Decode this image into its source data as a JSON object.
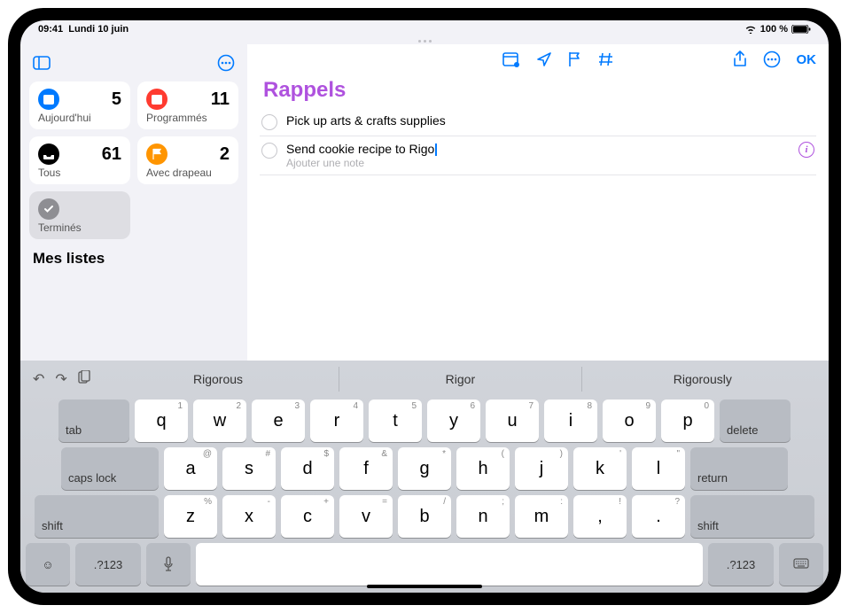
{
  "status": {
    "time": "09:41",
    "date": "Lundi 10 juin",
    "battery": "100 %"
  },
  "sidebar": {
    "smart": [
      {
        "label": "Aujourd'hui",
        "count": "5",
        "color": "#007aff",
        "icon": "cal"
      },
      {
        "label": "Programmés",
        "count": "11",
        "color": "#ff3b30",
        "icon": "cal"
      },
      {
        "label": "Tous",
        "count": "61",
        "color": "#000",
        "icon": "tray"
      },
      {
        "label": "Avec drapeau",
        "count": "2",
        "color": "#ff9500",
        "icon": "flag"
      },
      {
        "label": "Terminés",
        "count": "",
        "color": "#8e8e93",
        "icon": "check"
      }
    ],
    "section": "Mes listes"
  },
  "list": {
    "title": "Rappels",
    "items": [
      {
        "title": "Pick up arts & crafts supplies",
        "note": ""
      },
      {
        "title": "Send cookie recipe to Rigo",
        "note": "Ajouter une note"
      }
    ]
  },
  "toolbar": {
    "ok": "OK"
  },
  "keyboard": {
    "preds": [
      "Rigorous",
      "Rigor",
      "Rigorously"
    ],
    "row1": [
      [
        "q",
        "1"
      ],
      [
        "w",
        "2"
      ],
      [
        "e",
        "3"
      ],
      [
        "r",
        "4"
      ],
      [
        "t",
        "5"
      ],
      [
        "y",
        "6"
      ],
      [
        "u",
        "7"
      ],
      [
        "i",
        "8"
      ],
      [
        "o",
        "9"
      ],
      [
        "p",
        "0"
      ]
    ],
    "row2": [
      [
        "a",
        "@"
      ],
      [
        "s",
        "#"
      ],
      [
        "d",
        "$"
      ],
      [
        "f",
        "&"
      ],
      [
        "g",
        "*"
      ],
      [
        "h",
        "("
      ],
      [
        "j",
        ")"
      ],
      [
        "k",
        "'"
      ],
      [
        "l",
        "\""
      ]
    ],
    "row3": [
      [
        "z",
        "%"
      ],
      [
        "x",
        "-"
      ],
      [
        "c",
        "+"
      ],
      [
        "v",
        "="
      ],
      [
        "b",
        "/"
      ],
      [
        "n",
        ";"
      ],
      [
        "m",
        ":"
      ],
      [
        ",",
        "!"
      ],
      [
        ".",
        "?"
      ]
    ],
    "fn": {
      "tab": "tab",
      "delete": "delete",
      "caps": "caps lock",
      "return": "return",
      "shift": "shift",
      "sym": ".?123"
    }
  }
}
